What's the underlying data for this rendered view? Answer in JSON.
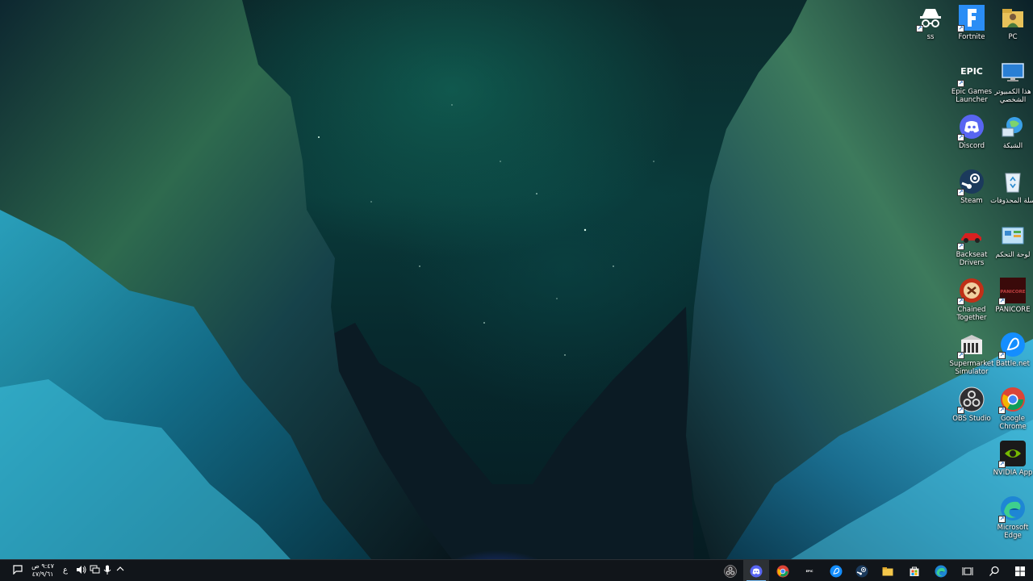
{
  "desktop": {
    "icons": [
      {
        "id": "pc",
        "label": "PC",
        "icon": "user-folder-icon"
      },
      {
        "id": "fortnite",
        "label": "Fortnite",
        "icon": "fortnite-icon"
      },
      {
        "id": "ss",
        "label": "ss",
        "icon": "incognito-icon"
      },
      {
        "id": "this-pc",
        "label": "هذا الكمبيوتر الشخصي",
        "icon": "computer-icon"
      },
      {
        "id": "epic",
        "label": "Epic Games Launcher",
        "icon": "epic-games-icon",
        "glyph_text": "EPIC"
      },
      {
        "id": "network",
        "label": "الشبكة",
        "icon": "network-globe-icon"
      },
      {
        "id": "discord",
        "label": "Discord",
        "icon": "discord-icon"
      },
      {
        "id": "recycle",
        "label": "سلة المحذوفات",
        "icon": "recycle-bin-icon"
      },
      {
        "id": "steam",
        "label": "Steam",
        "icon": "steam-icon"
      },
      {
        "id": "control-panel",
        "label": "لوحة التحكم",
        "icon": "control-panel-icon"
      },
      {
        "id": "backseat",
        "label": "Backseat Drivers",
        "icon": "red-car-icon"
      },
      {
        "id": "panicore",
        "label": "PANICORE",
        "icon": "panicore-icon",
        "glyph_text": "PANICORE"
      },
      {
        "id": "chained",
        "label": "Chained Together",
        "icon": "chained-together-icon"
      },
      {
        "id": "battlenet",
        "label": "Battle.net",
        "icon": "battlenet-icon"
      },
      {
        "id": "supermarket",
        "label": "Supermarket Simulator",
        "icon": "supermarket-icon"
      },
      {
        "id": "chrome",
        "label": "Google Chrome",
        "icon": "chrome-icon"
      },
      {
        "id": "obs",
        "label": "OBS Studio",
        "icon": "obs-icon"
      },
      {
        "id": "nvidia",
        "label": "NVIDIA App",
        "icon": "nvidia-icon"
      },
      {
        "id": "edge",
        "label": "Microsoft Edge",
        "icon": "edge-icon"
      }
    ]
  },
  "taskbar": {
    "clock": {
      "time": "٩:٤٧ ص",
      "date": "٤٧/٩/٦١"
    },
    "language": "ع",
    "pinned": [
      {
        "id": "obs",
        "icon": "obs-icon",
        "active": false
      },
      {
        "id": "discord",
        "icon": "discord-icon",
        "active": true
      },
      {
        "id": "chrome",
        "icon": "chrome-icon",
        "active": false
      },
      {
        "id": "epic",
        "icon": "epic-games-icon",
        "active": false,
        "glyph_text": "EPIC"
      },
      {
        "id": "battlenet",
        "icon": "battlenet-icon",
        "active": false
      },
      {
        "id": "steam",
        "icon": "steam-icon",
        "active": false
      },
      {
        "id": "explorer",
        "icon": "folder-icon",
        "active": false
      },
      {
        "id": "store",
        "icon": "store-icon",
        "active": false
      },
      {
        "id": "edge",
        "icon": "edge-icon",
        "active": false
      },
      {
        "id": "taskview",
        "icon": "task-view-icon",
        "active": false
      },
      {
        "id": "search",
        "icon": "search-icon",
        "active": false
      },
      {
        "id": "start",
        "icon": "windows-start-icon",
        "active": false
      }
    ]
  },
  "colors": {
    "taskbar_bg": "#12161a",
    "accent": "#76b9ed",
    "discord": "#5865f2",
    "nvidia": "#76b900",
    "fortnite": "#2a8df5"
  }
}
